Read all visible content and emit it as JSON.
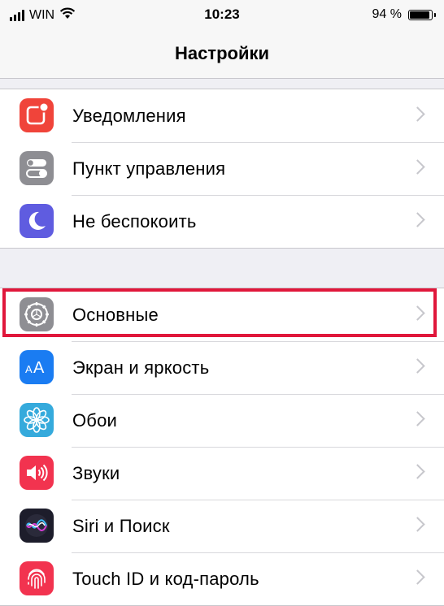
{
  "status_bar": {
    "carrier": "WIN",
    "time": "10:23",
    "battery": "94 %"
  },
  "nav": {
    "title": "Настройки"
  },
  "groups": [
    {
      "items": [
        {
          "label": "Уведомления",
          "icon": "notifications-icon",
          "color": "#f0443a"
        },
        {
          "label": "Пункт управления",
          "icon": "control-center-icon",
          "color": "#8e8e93"
        },
        {
          "label": "Не беспокоить",
          "icon": "moon-icon",
          "color": "#5f5ce0"
        }
      ]
    },
    {
      "items": [
        {
          "label": "Основные",
          "icon": "gear-icon",
          "color": "#8e8e93"
        },
        {
          "label": "Экран и яркость",
          "icon": "display-aa-icon",
          "color": "#1a7cf2"
        },
        {
          "label": "Обои",
          "icon": "wallpaper-flower-icon",
          "color": "#35aadc"
        },
        {
          "label": "Звуки",
          "icon": "speaker-icon",
          "color": "#f2334f"
        },
        {
          "label": "Siri и Поиск",
          "icon": "siri-icon",
          "color": "#222222"
        },
        {
          "label": "Touch ID и код-пароль",
          "icon": "fingerprint-icon",
          "color": "#f2334f"
        }
      ]
    }
  ],
  "highlight_color": "#e0173b"
}
